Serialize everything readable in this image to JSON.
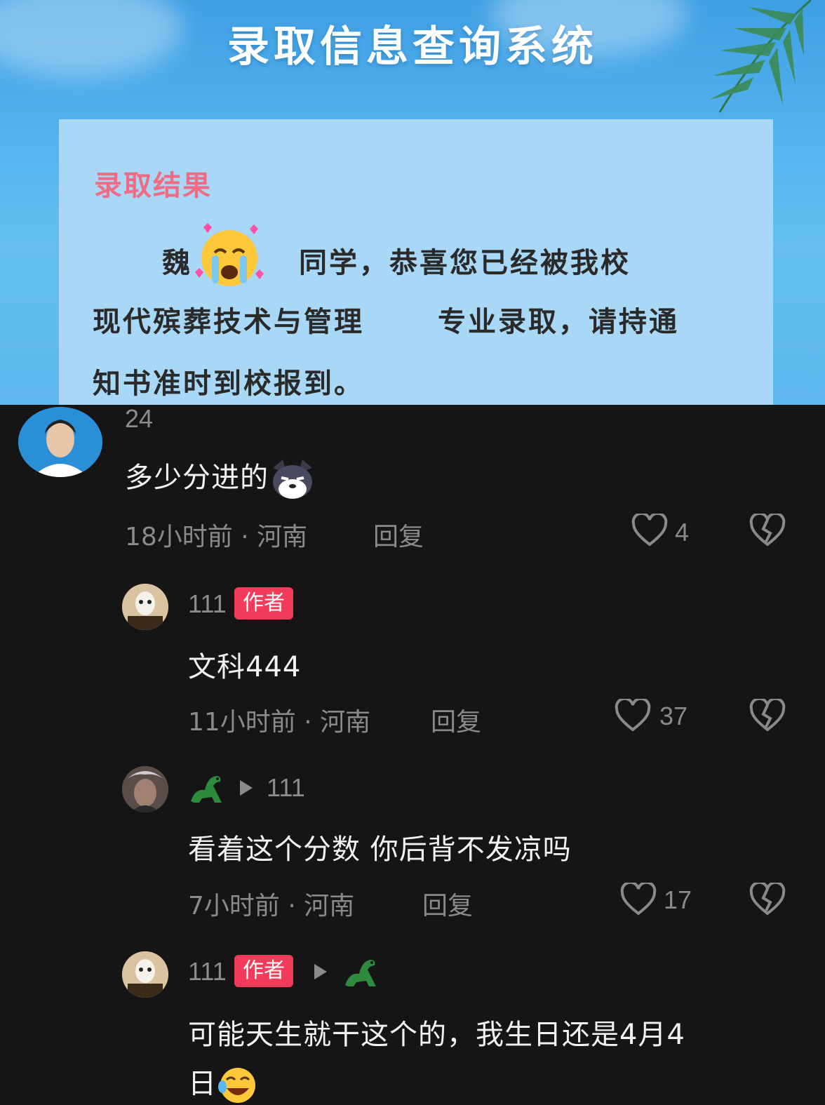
{
  "banner": {
    "title": "录取信息查询系统",
    "card_heading": "录取结果",
    "line1_name": "魏",
    "line1_rest": "同学，恭喜您已经被我校",
    "line2_major": "现代殡葬技术与管理",
    "line2_rest": "专业录取，请持通",
    "line3": "知书准时到校报到。"
  },
  "comments": [
    {
      "username": "24",
      "text": "多少分进的",
      "meta": "18小时前 · 河南",
      "reply": "回复",
      "likes": "4"
    },
    {
      "username": "111",
      "badge": "作者",
      "text": "文科444",
      "meta": "11小时前 · 河南",
      "reply": "回复",
      "likes": "37"
    },
    {
      "reply_to": "111",
      "text": "看着这个分数 你后背不发凉吗",
      "meta": "7小时前 · 河南",
      "reply": "回复",
      "likes": "17"
    },
    {
      "username": "111",
      "badge": "作者",
      "text_line1": "可能天生就干这个的，我生日还是4月4",
      "text_line2": "日"
    }
  ],
  "icons": {
    "like": "heart-outline-icon",
    "dislike": "broken-heart-icon",
    "emoji_cry": "crying-face-emoji",
    "emoji_dog": "smirking-dog-emoji",
    "emoji_laugh": "rolling-laugh-emoji",
    "dino": "dinosaur-emoji"
  },
  "colors": {
    "badge": "#f03c5a",
    "card_heading": "#ef6c84",
    "background": "#151515"
  }
}
